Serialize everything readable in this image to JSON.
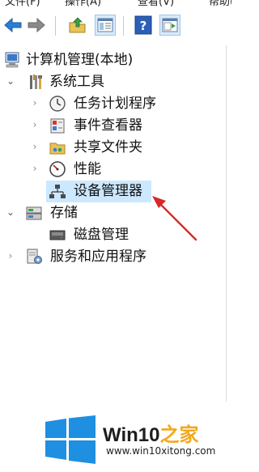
{
  "menubar": {
    "items": [
      "文件(F)",
      "操作(A)",
      "查看(V)",
      "帮助(H)"
    ]
  },
  "toolbar": {
    "buttons": [
      "back-icon",
      "forward-icon",
      "up-folder-icon",
      "show-hide-tree-icon",
      "help-icon",
      "properties-pane-icon"
    ]
  },
  "tree": {
    "root": {
      "label": "计算机管理(本地)"
    },
    "system_tools": {
      "label": "系统工具"
    },
    "task_scheduler": {
      "label": "任务计划程序"
    },
    "event_viewer": {
      "label": "事件查看器"
    },
    "shared_folders": {
      "label": "共享文件夹"
    },
    "performance": {
      "label": "性能"
    },
    "device_manager": {
      "label": "设备管理器"
    },
    "storage": {
      "label": "存储"
    },
    "disk_management": {
      "label": "磁盘管理"
    },
    "services_apps": {
      "label": "服务和应用程序"
    }
  },
  "watermark": {
    "brand_prefix": "Win10",
    "brand_suffix": "之家",
    "site": "www.win10xitong.com"
  },
  "colors": {
    "selection": "#cce8ff",
    "annotation_arrow": "#d62a2a",
    "brand_blue": "#1e8fe1",
    "brand_orange": "#f3a81c"
  }
}
